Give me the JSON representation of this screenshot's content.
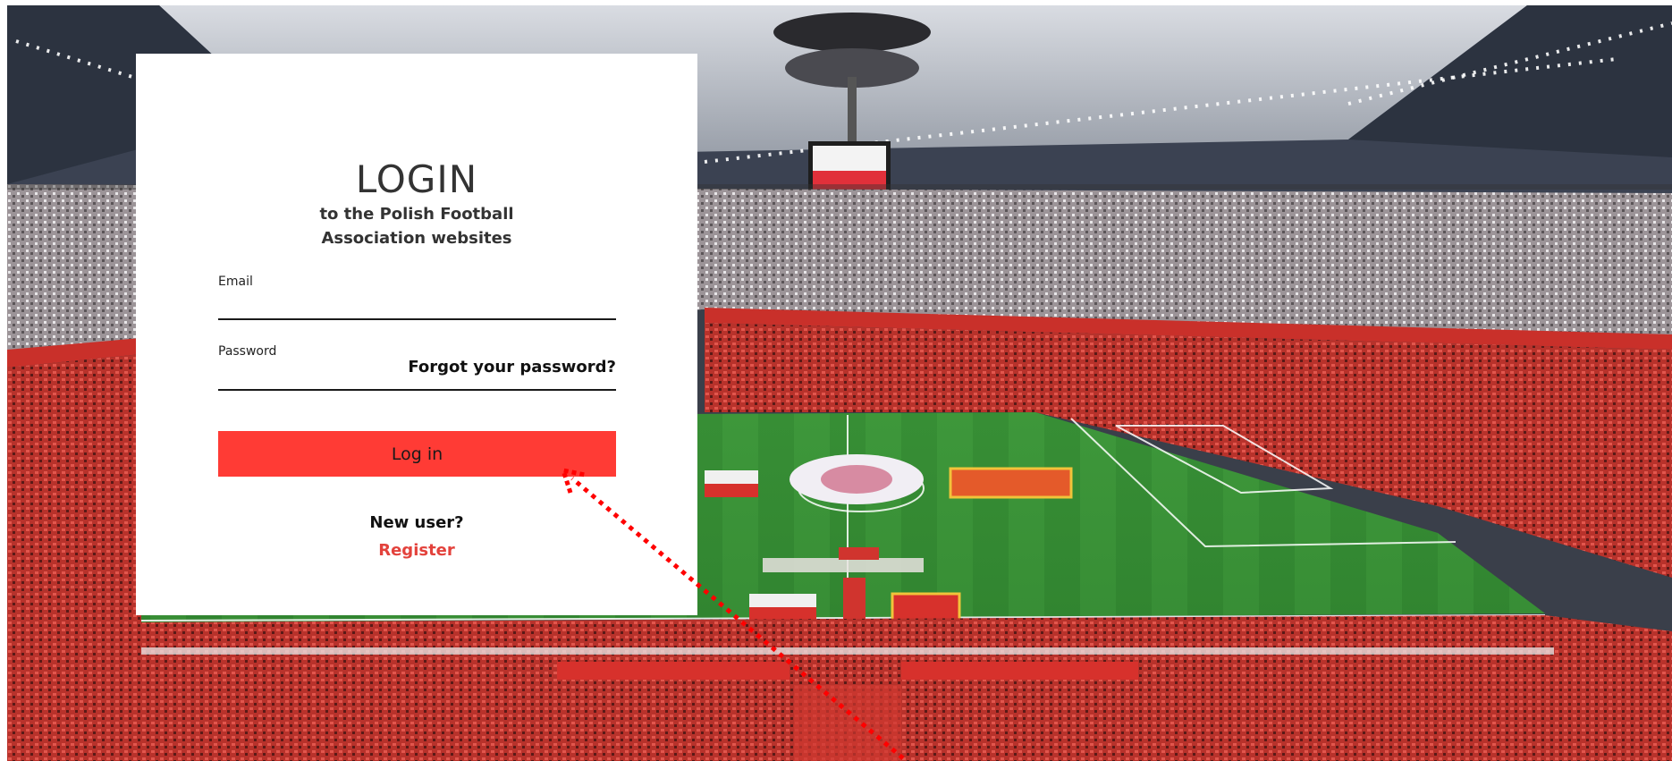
{
  "login": {
    "title": "LOGIN",
    "subtitle_line1": "to the Polish Football",
    "subtitle_line2": "Association websites",
    "email_label": "Email",
    "email_value": "",
    "password_label": "Password",
    "password_value": "",
    "forgot_link": "Forgot your password?",
    "login_button": "Log in",
    "new_user_text": "New user?",
    "register_link": "Register"
  },
  "colors": {
    "button": "#ff3b35",
    "register_link": "#e3423c",
    "annotation_arrow": "#ff0000"
  },
  "icons": {
    "annotation": "dotted-arrow-icon"
  }
}
